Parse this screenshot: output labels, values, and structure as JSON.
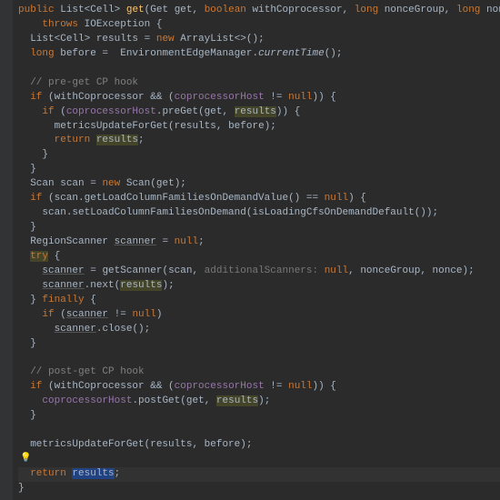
{
  "code": {
    "kw_public": "public",
    "type_list": "List",
    "type_cell": "Cell",
    "method_get": "get",
    "type_get": "Get",
    "param_get": "get",
    "kw_boolean": "boolean",
    "param_withCoprocessor": "withCoprocessor",
    "kw_long": "long",
    "param_nonceGroup": "nonceGroup",
    "param_nonce": "nonce",
    "kw_throws": "throws",
    "type_ioexception": "IOException",
    "var_results": "results",
    "kw_new": "new",
    "type_arraylist": "ArrayList",
    "var_before": "before",
    "type_envmgr": "EnvironmentEdgeManager",
    "method_currentTime": "currentTime",
    "comment_preget": "// pre-get CP hook",
    "kw_if": "if",
    "field_coprocessorHost": "coprocessorHost",
    "kw_null": "null",
    "method_preGet": "preGet",
    "method_metricsUpdate": "metricsUpdateForGet",
    "kw_return": "return",
    "type_scan": "Scan",
    "var_scan": "scan",
    "method_getLoadCol": "getLoadColumnFamiliesOnDemandValue",
    "method_setLoadCol": "setLoadColumnFamiliesOnDemand",
    "method_isLoading": "isLoadingCfsOnDemandDefault",
    "type_regionscanner": "RegionScanner",
    "var_scanner": "scanner",
    "kw_try": "try",
    "method_getScanner": "getScanner",
    "hint_additional": "additionalScanners:",
    "method_next": "next",
    "kw_finally": "finally",
    "method_close": "close",
    "comment_postget": "// post-get CP hook",
    "method_postGet": "postGet",
    "bulb": "💡"
  }
}
